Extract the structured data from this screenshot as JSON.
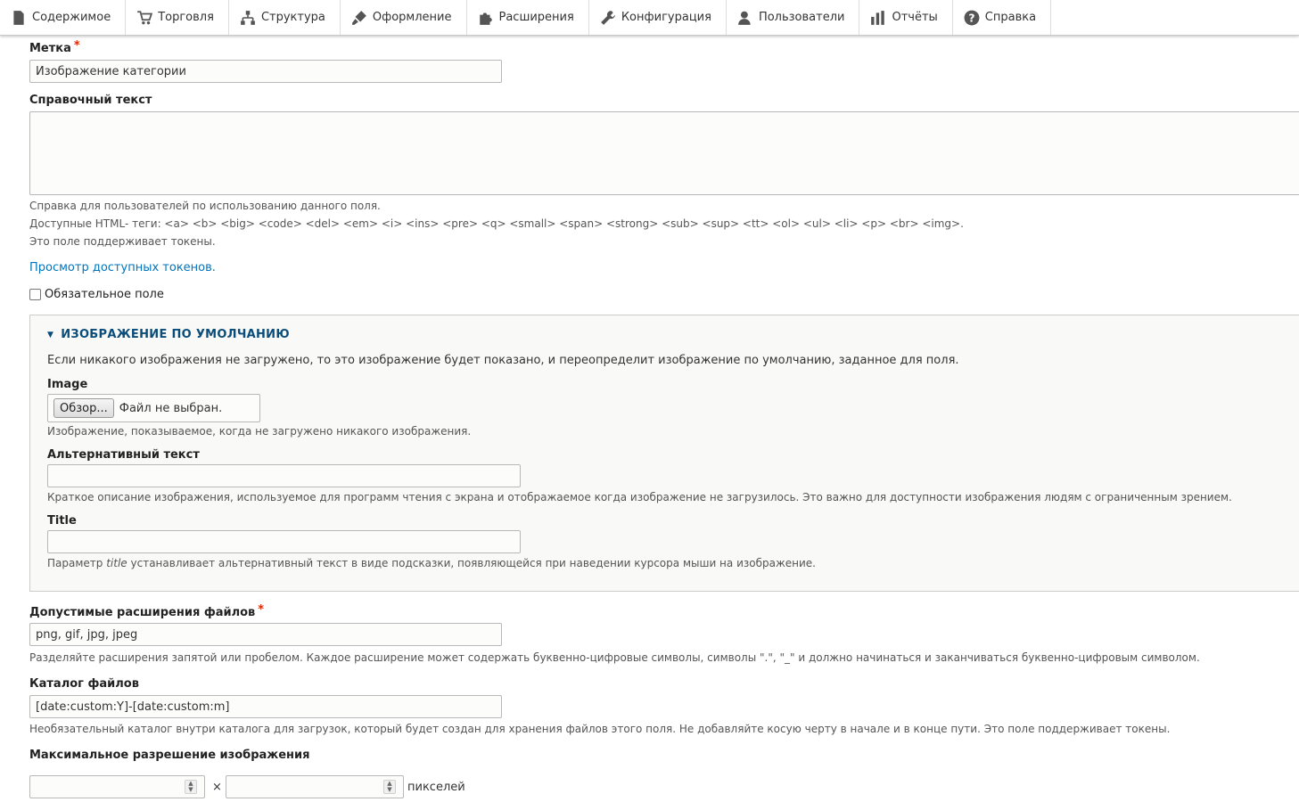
{
  "toolbar": {
    "items": [
      {
        "label": "Содержимое",
        "icon": "file-icon"
      },
      {
        "label": "Торговля",
        "icon": "cart-icon"
      },
      {
        "label": "Структура",
        "icon": "structure-icon"
      },
      {
        "label": "Оформление",
        "icon": "paintbrush-icon"
      },
      {
        "label": "Расширения",
        "icon": "puzzle-icon"
      },
      {
        "label": "Конфигурация",
        "icon": "wrench-icon"
      },
      {
        "label": "Пользователи",
        "icon": "user-icon"
      },
      {
        "label": "Отчёты",
        "icon": "bar-chart-icon"
      },
      {
        "label": "Справка",
        "icon": "help-icon"
      }
    ]
  },
  "form": {
    "label_field": {
      "label": "Метка",
      "required_mark": "*",
      "value": "Изображение категории"
    },
    "help_text": {
      "label": "Справочный текст",
      "value": "",
      "desc_1": "Справка для пользователей по использованию данного поля.",
      "desc_2": "Доступные HTML- теги: <a> <b> <big> <code> <del> <em> <i> <ins> <pre> <q> <small> <span> <strong> <sub> <sup> <tt> <ol> <ul> <li> <p> <br> <img>.",
      "desc_3": "Это поле поддерживает токены."
    },
    "tokens_link": "Просмотр доступных токенов.",
    "required_checkbox": {
      "label": "Обязательное поле",
      "checked": false
    },
    "default_image": {
      "legend": "ИЗОБРАЖЕНИЕ ПО УМОЛЧАНИЮ",
      "intro": "Если никакого изображения не загружено, то это изображение будет показано, и переопределит изображение по умолчанию, заданное для поля.",
      "image": {
        "label": "Image",
        "button": "Обзор...",
        "status": "Файл не выбран.",
        "desc": "Изображение, показываемое, когда не загружено никакого изображения."
      },
      "alt": {
        "label": "Альтернативный текст",
        "value": "",
        "desc": "Краткое описание изображения, используемое для программ чтения с экрана и отображаемое когда изображение не загрузилось. Это важно для доступности изображения людям с ограниченным зрением."
      },
      "title": {
        "label": "Title",
        "value": "",
        "desc_before": "Параметр ",
        "desc_em": "title",
        "desc_after": " устанавливает альтернативный текст в виде подсказки, появляющейся при наведении курсора мыши на изображение."
      }
    },
    "extensions": {
      "label": "Допустимые расширения файлов",
      "required_mark": "*",
      "value": "png, gif, jpg, jpeg",
      "desc": "Разделяйте расширения запятой или пробелом. Каждое расширение может содержать буквенно-цифровые символы, символы \".\", \"_\" и должно начинаться и заканчиваться буквенно-цифровым символом."
    },
    "directory": {
      "label": "Каталог файлов",
      "value": "[date:custom:Y]-[date:custom:m]",
      "desc": "Необязательный каталог внутри каталога для загрузок, который будет создан для хранения файлов этого поля. Не добавляйте косую черту в начале и в конце пути. Это поле поддерживает токены."
    },
    "max_resolution": {
      "label": "Максимальное разрешение изображения",
      "width": "",
      "height": "",
      "separator": "×",
      "unit": "пикселей"
    }
  }
}
